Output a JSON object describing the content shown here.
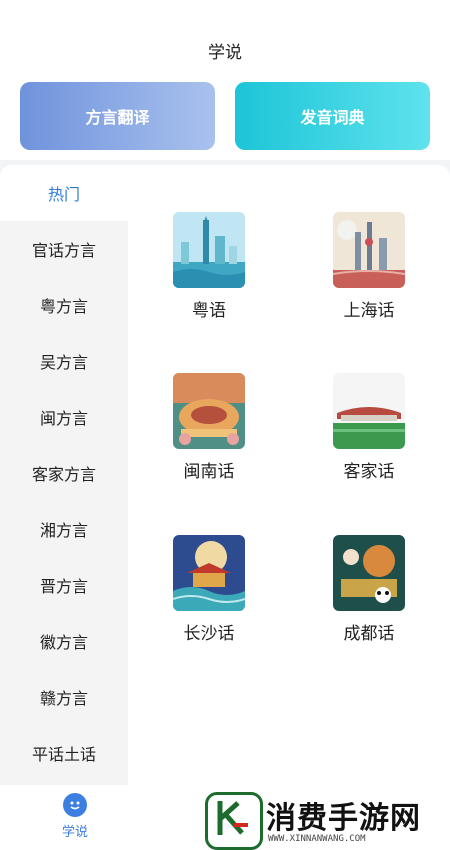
{
  "header": {
    "title": "学说",
    "buttons": [
      {
        "label": "方言翻译"
      },
      {
        "label": "发音词典"
      }
    ]
  },
  "sidebar": {
    "items": [
      {
        "label": "热门",
        "active": true
      },
      {
        "label": "官话方言"
      },
      {
        "label": "粤方言"
      },
      {
        "label": "吴方言"
      },
      {
        "label": "闽方言"
      },
      {
        "label": "客家方言"
      },
      {
        "label": "湘方言"
      },
      {
        "label": "晋方言"
      },
      {
        "label": "徽方言"
      },
      {
        "label": "赣方言"
      },
      {
        "label": "平话土话"
      }
    ]
  },
  "dialects": [
    {
      "label": "粤语",
      "thumb": "guangzhou-skyline-image"
    },
    {
      "label": "上海话",
      "thumb": "shanghai-skyline-image"
    },
    {
      "label": "闽南话",
      "thumb": "tulou-image"
    },
    {
      "label": "客家话",
      "thumb": "stadium-image"
    },
    {
      "label": "长沙话",
      "thumb": "pavilion-image"
    },
    {
      "label": "成都话",
      "thumb": "panda-opera-image"
    }
  ],
  "tabbar": {
    "tabs": [
      {
        "label": "学说",
        "icon": "chat-smile-icon",
        "active": true
      }
    ]
  },
  "watermark": {
    "title": "消费手游网",
    "url": "WWW.XINNANWANG.COM"
  },
  "colors": {
    "accent": "#2f7bd8",
    "translate_gradient": [
      "#6f93dc",
      "#a9c1ee"
    ],
    "dict_gradient": [
      "#1cc5d7",
      "#5fe2ee"
    ]
  }
}
